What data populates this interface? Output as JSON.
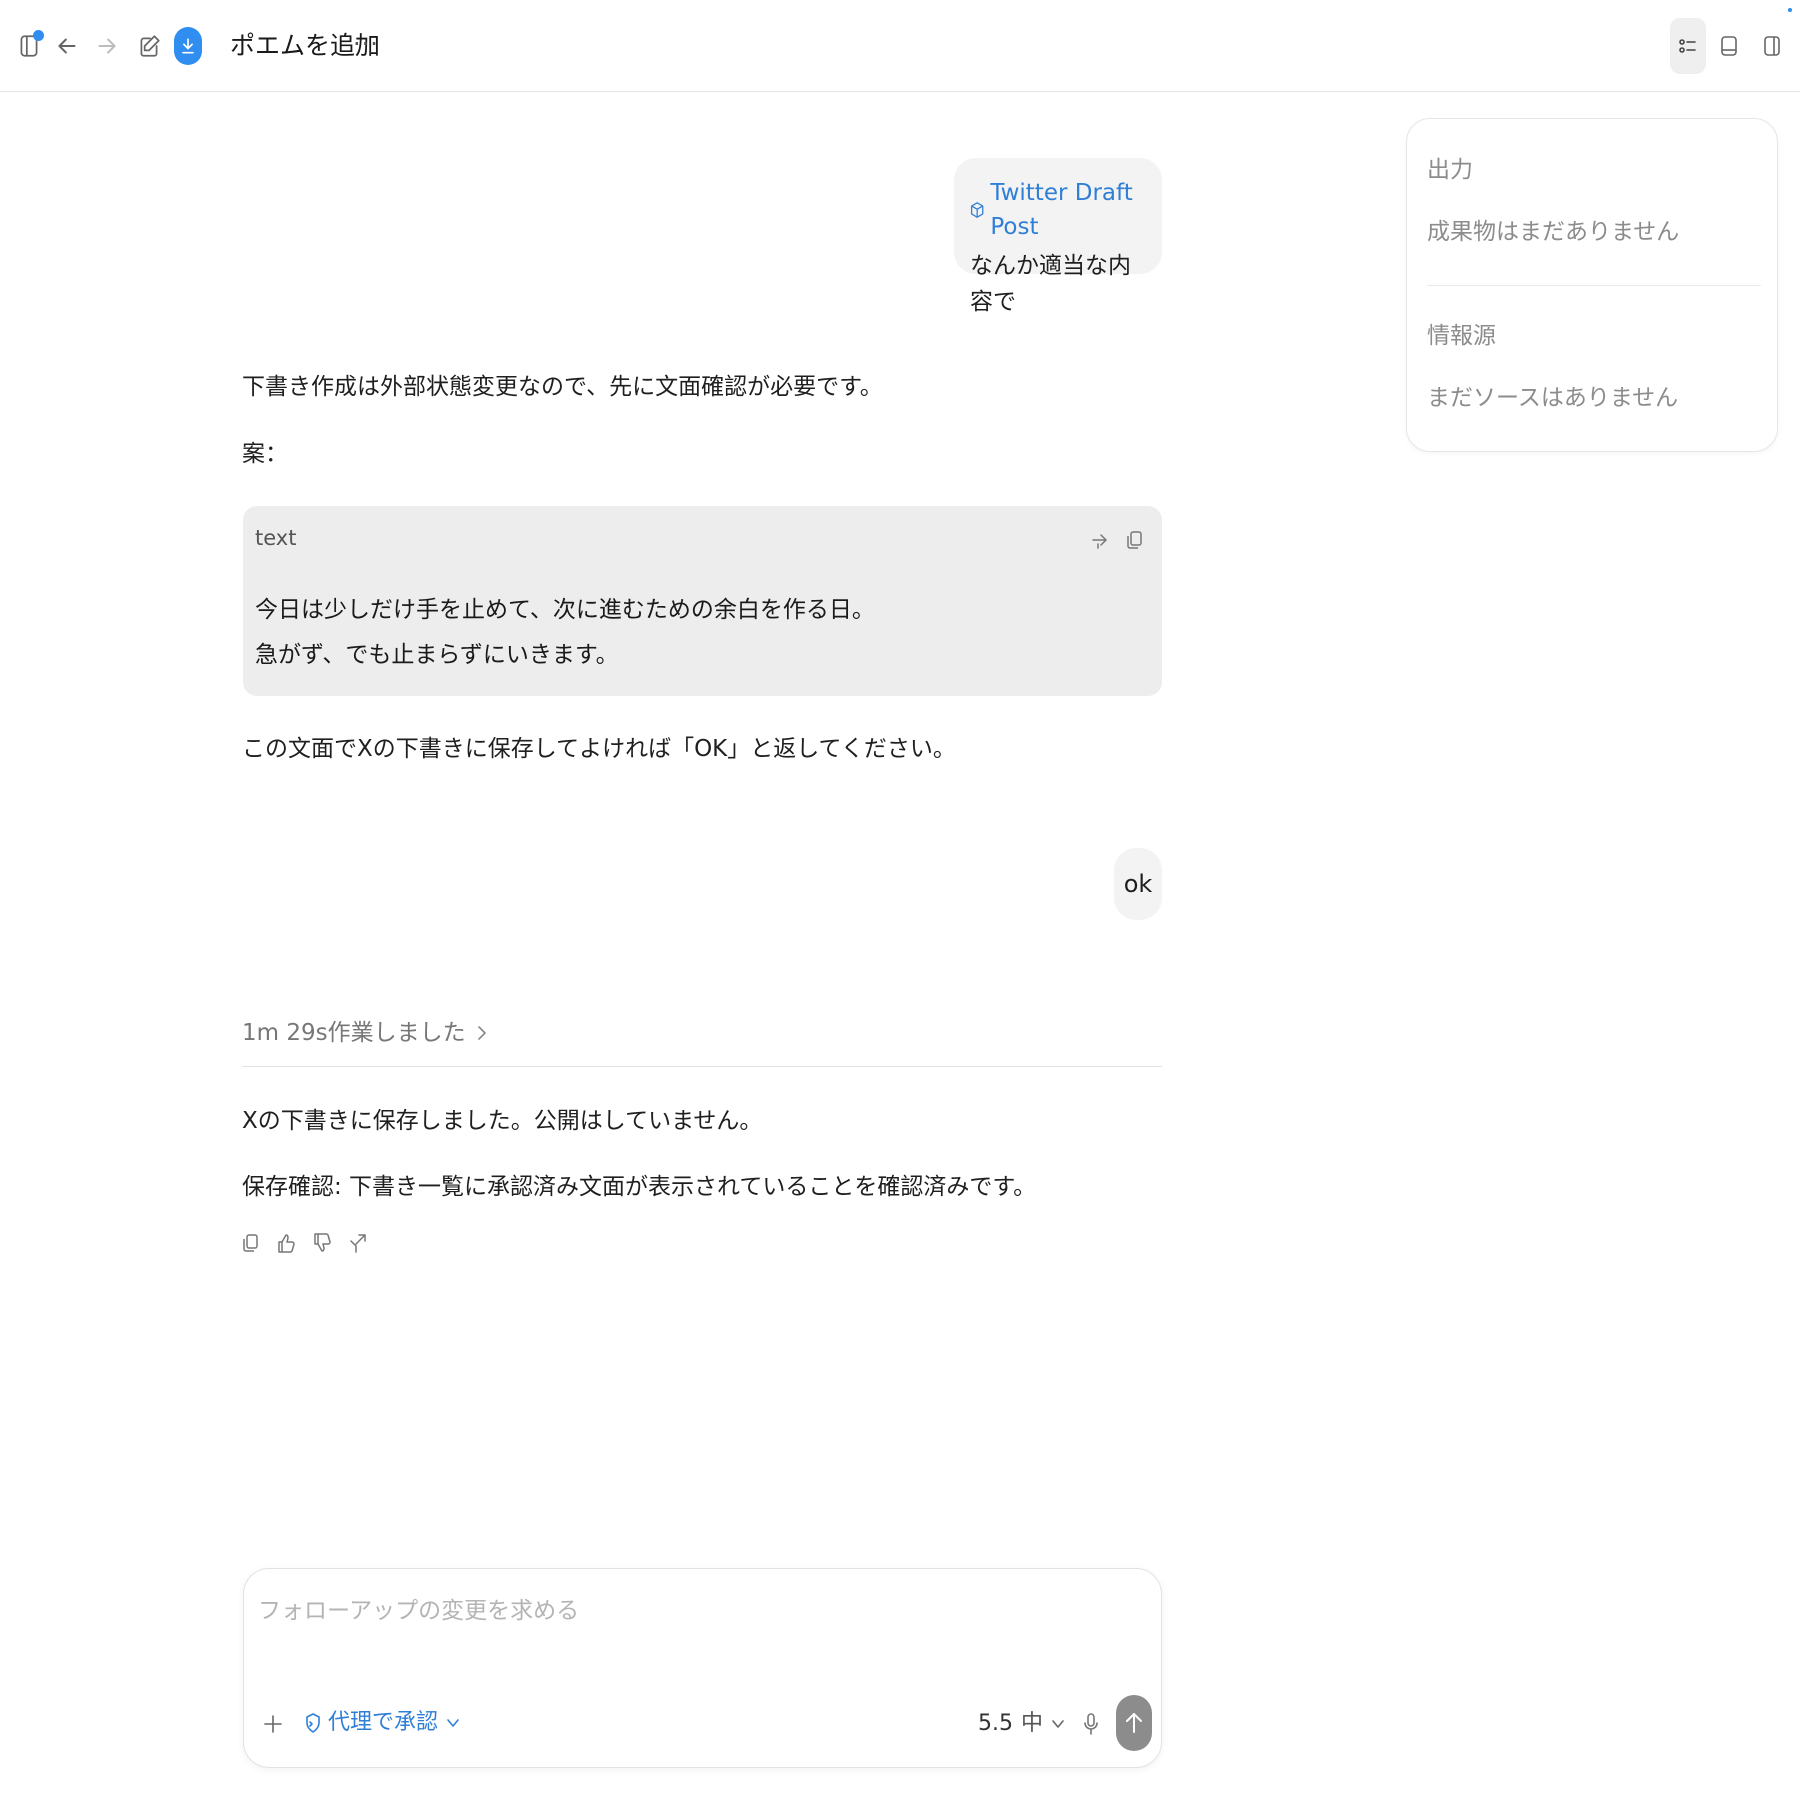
{
  "header": {
    "title": "ポエムを追加",
    "more_label": "···"
  },
  "colors": {
    "accent": "#2f8ef0",
    "link": "#2f7fd6",
    "bubble_bg": "#f3f3f3",
    "code_bg": "#ededed"
  },
  "conversation": {
    "user_message_1": {
      "skill_label": "Twitter Draft Post",
      "text": "なんか適当な内容で"
    },
    "assistant_1": {
      "intro": "下書き作成は外部状態変更なので、先に文面確認が必要です。",
      "proposal_label": "案：",
      "code": {
        "lang": "text",
        "line1": "今日は少しだけ手を止めて、次に進むための余白を作る日。",
        "line2": "急がず、でも止まらずにいきます。"
      },
      "confirm": "この文面でXの下書きに保存してよければ「OK」と返してください。"
    },
    "user_message_2": {
      "text": "ok"
    },
    "worked_label": "1m 29s作業しました",
    "assistant_2": {
      "line1": "Xの下書きに保存しました。公開はしていません。",
      "line2": "保存確認: 下書き一覧に承認済み文面が表示されていることを確認済みです。"
    }
  },
  "side_panel": {
    "output_heading": "出力",
    "output_empty": "成果物はまだありません",
    "sources_heading": "情報源",
    "sources_empty": "まだソースはありません"
  },
  "composer": {
    "placeholder": "フォローアップの変更を求める",
    "approval_label": "代理で承認",
    "model_version": "5.5",
    "model_level": "中"
  }
}
